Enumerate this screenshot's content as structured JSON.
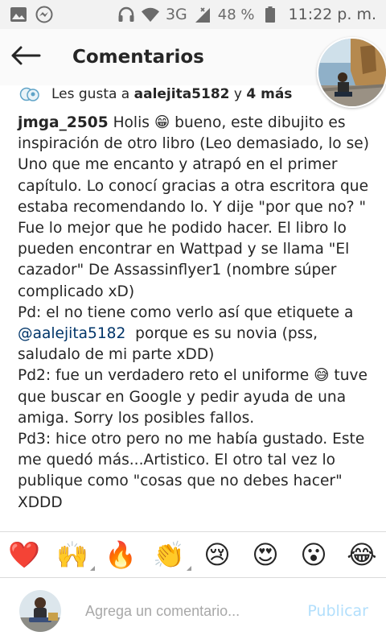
{
  "status_bar": {
    "network": "3G",
    "battery": "48 %",
    "time": "11:22 p. m.",
    "icons": [
      "gallery-icon",
      "messenger-icon",
      "headphones-icon",
      "wifi-icon",
      "signal-icon",
      "battery-icon"
    ]
  },
  "header": {
    "title": "Comentarios",
    "back_icon": "arrow-left-icon"
  },
  "likes": {
    "prefix": "Les gusta a",
    "user": "aalejita5182",
    "connector": "y",
    "more": "4 más"
  },
  "comment": {
    "username": "jmga_2505",
    "part1": " Holis 😁 bueno, este dibujito es inspiración de otro libro (Leo demasiado, lo se) Uno que me encanto y atrapó en el primer capítulo. Lo conocí gracias a otra escritora que estaba recomendando lo. Y dije \"por que no? \" Fue lo mejor que he podido hacer. El libro lo pueden encontrar en Wattpad y se llama \"El cazador\" De Assassinflyer1 (nombre súper complicado xD)\nPd: el no tiene como verlo así que etiquete a ",
    "mention": "@aalejita5182",
    "part2": "  porque es su novia (pss, saludalo de mi parte xDD)\nPd2: fue un verdadero reto el uniforme 😅 tuve que buscar en Google y pedir ayuda de una amiga. Sorry los posibles fallos.\nPd3: hice otro pero no me había gustado. Este me quedó más...Artistico. El otro tal vez lo publique como \"cosas que no debes hacer\" XDDD"
  },
  "emoji_bar": [
    {
      "emoji": "❤️",
      "name": "heart"
    },
    {
      "emoji": "🙌",
      "name": "raising-hands"
    },
    {
      "emoji": "🔥",
      "name": "fire"
    },
    {
      "emoji": "👏",
      "name": "clapping-hands"
    },
    {
      "emoji": "😢",
      "name": "crying-face"
    },
    {
      "emoji": "😍",
      "name": "heart-eyes"
    },
    {
      "emoji": "😮",
      "name": "surprised-face"
    },
    {
      "emoji": "😂",
      "name": "tears-of-joy"
    }
  ],
  "composer": {
    "placeholder": "Agrega un comentario...",
    "publish_label": "Publicar"
  },
  "colors": {
    "text": "#262626",
    "mention": "#003569",
    "publish_disabled": "#b2dffc",
    "status_bar_bg": "#f2f2f2"
  }
}
